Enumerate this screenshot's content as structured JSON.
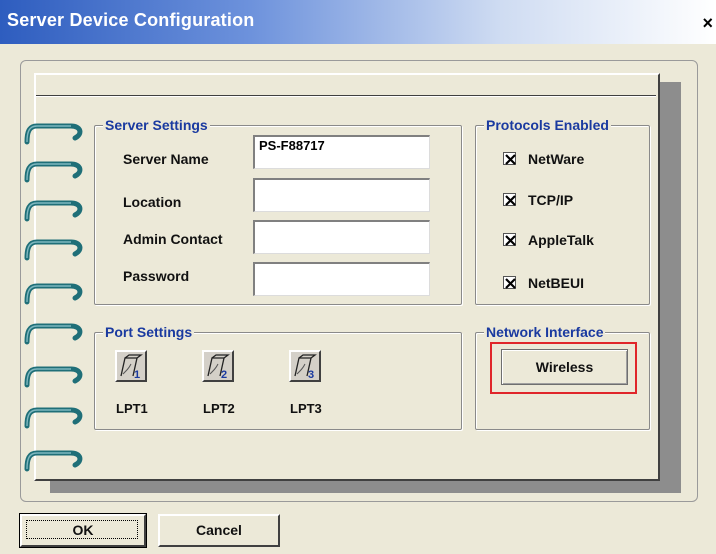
{
  "window": {
    "title": "Server Device Configuration",
    "close_glyph": "×"
  },
  "server_settings": {
    "title": "Server Settings",
    "fields": [
      {
        "label": "Server Name",
        "value": "PS-F88717"
      },
      {
        "label": "Location",
        "value": ""
      },
      {
        "label": "Admin Contact",
        "value": ""
      },
      {
        "label": "Password",
        "value": ""
      }
    ]
  },
  "protocols": {
    "title": "Protocols Enabled",
    "items": [
      {
        "label": "NetWare",
        "checked": true
      },
      {
        "label": "TCP/IP",
        "checked": true
      },
      {
        "label": "AppleTalk",
        "checked": true
      },
      {
        "label": "NetBEUI",
        "checked": true
      }
    ]
  },
  "port_settings": {
    "title": "Port Settings",
    "ports": [
      {
        "label": "LPT1",
        "number": "1",
        "icon": "printer-port-icon"
      },
      {
        "label": "LPT2",
        "number": "2",
        "icon": "printer-port-icon"
      },
      {
        "label": "LPT3",
        "number": "3",
        "icon": "printer-port-icon"
      }
    ]
  },
  "network_interface": {
    "title": "Network Interface",
    "button_label": "Wireless"
  },
  "buttons": {
    "ok": "OK",
    "cancel": "Cancel"
  },
  "colors": {
    "ring": "#1f6f78",
    "group_title": "#1a3aa0",
    "highlight": "#e0262a",
    "title_bar": "#2e5dbf"
  }
}
